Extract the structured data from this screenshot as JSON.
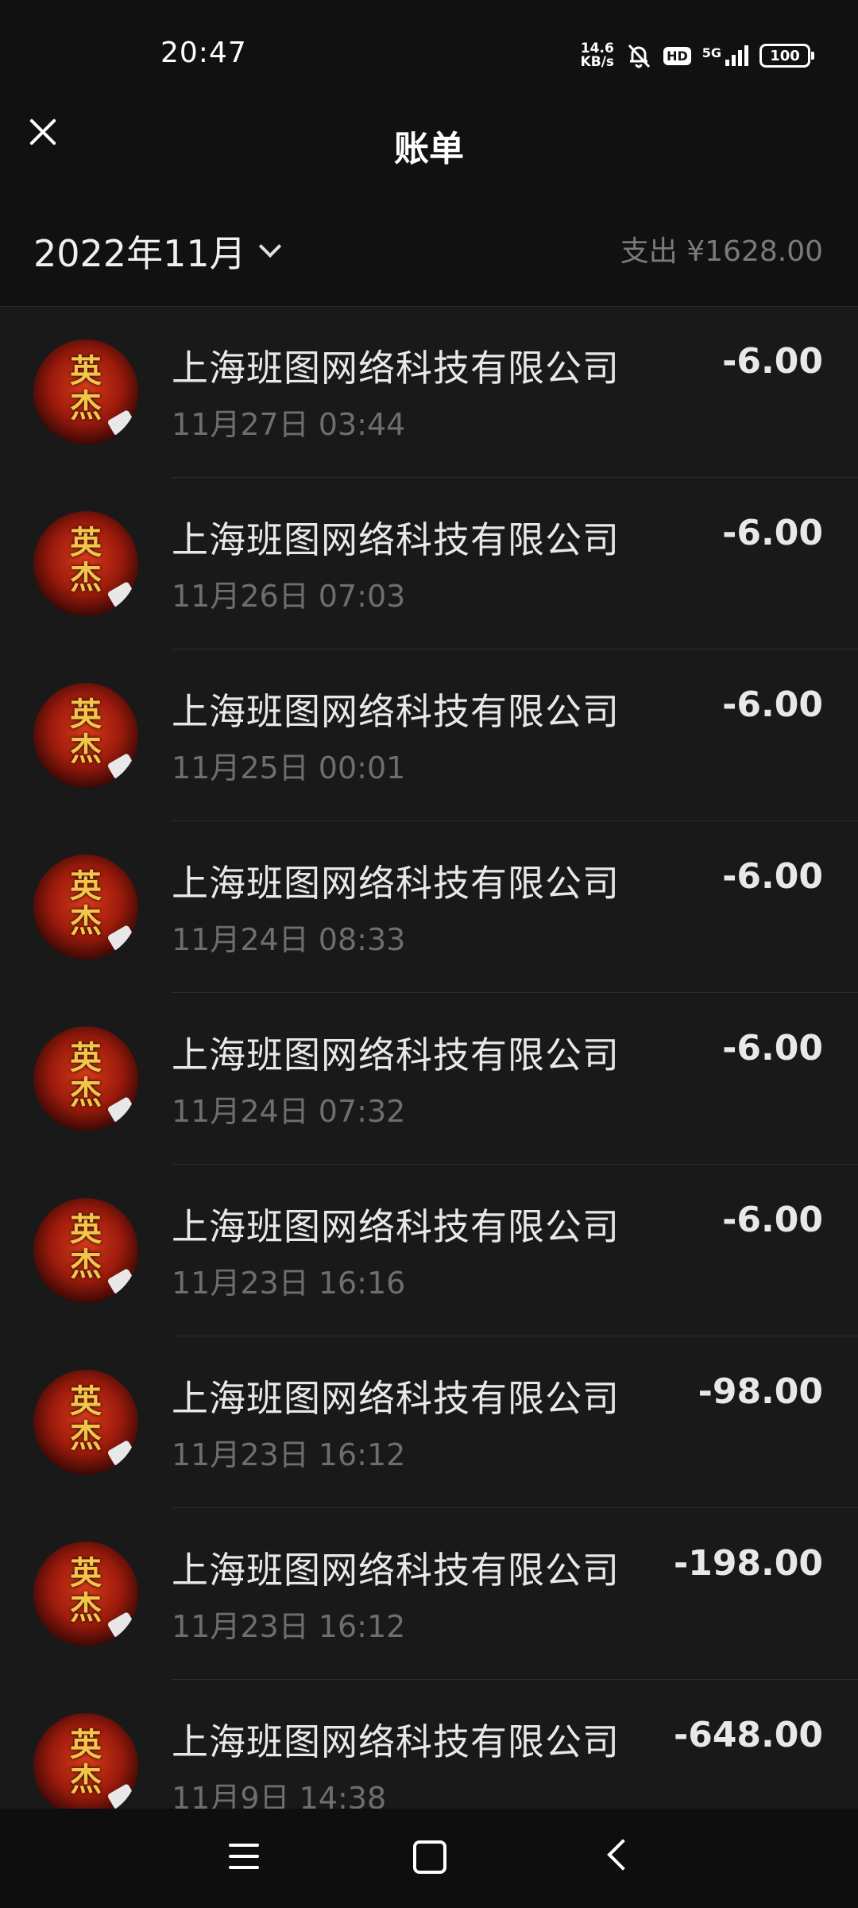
{
  "status": {
    "time": "20:47",
    "net_speed_value": "14.6",
    "net_speed_unit": "KB/s",
    "hd_label": "HD",
    "network_label": "5G",
    "battery": "100",
    "icons": [
      "net-speed-icon",
      "bell-off-icon",
      "hd-icon",
      "signal-5g-icon",
      "battery-icon"
    ]
  },
  "header": {
    "title": "账单",
    "close_icon": "close-icon"
  },
  "month_bar": {
    "month": "2022年11月",
    "summary": "支出 ¥1628.00"
  },
  "transactions": [
    {
      "merchant": "上海班图网络科技有限公司",
      "time": "11月27日 03:44",
      "amount": "-6.00"
    },
    {
      "merchant": "上海班图网络科技有限公司",
      "time": "11月26日 07:03",
      "amount": "-6.00"
    },
    {
      "merchant": "上海班图网络科技有限公司",
      "time": "11月25日 00:01",
      "amount": "-6.00"
    },
    {
      "merchant": "上海班图网络科技有限公司",
      "time": "11月24日 08:33",
      "amount": "-6.00"
    },
    {
      "merchant": "上海班图网络科技有限公司",
      "time": "11月24日 07:32",
      "amount": "-6.00"
    },
    {
      "merchant": "上海班图网络科技有限公司",
      "time": "11月23日 16:16",
      "amount": "-6.00"
    },
    {
      "merchant": "上海班图网络科技有限公司",
      "time": "11月23日 16:12",
      "amount": "-98.00"
    },
    {
      "merchant": "上海班图网络科技有限公司",
      "time": "11月23日 16:12",
      "amount": "-198.00"
    },
    {
      "merchant": "上海班图网络科技有限公司",
      "time": "11月9日 14:38",
      "amount": "-648.00"
    }
  ],
  "avatar_logo_text": "英杰",
  "navbar": {
    "icons": [
      "menu-icon",
      "home-icon",
      "back-icon"
    ]
  }
}
